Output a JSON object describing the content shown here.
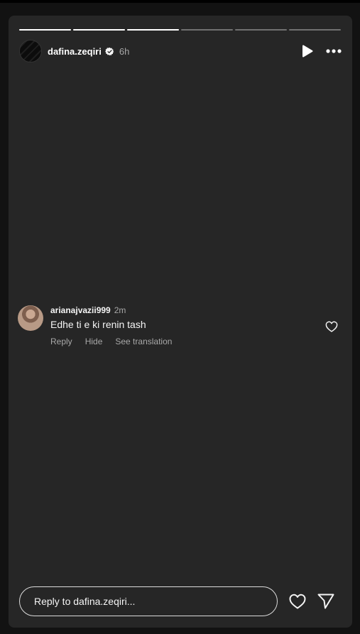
{
  "story": {
    "progress_segments": [
      {
        "fill": 1.0
      },
      {
        "fill": 1.0
      },
      {
        "fill": 1.0
      },
      {
        "fill": 0.0
      },
      {
        "fill": 0.0
      },
      {
        "fill": 0.0
      }
    ],
    "header": {
      "username": "dafina.zeqiri",
      "verified": true,
      "time": "6h",
      "play_icon": "play-icon",
      "more_icon": "more-horizontal-icon"
    },
    "comment": {
      "username": "arianajvazii999",
      "time": "2m",
      "text": "Edhe ti e ki renin tash",
      "actions": {
        "reply": "Reply",
        "hide": "Hide",
        "translate": "See translation"
      },
      "like_icon": "heart-outline-icon"
    },
    "footer": {
      "reply_placeholder": "Reply to dafina.zeqiri...",
      "like_icon": "heart-outline-icon",
      "share_icon": "send-icon"
    }
  },
  "colors": {
    "story_bg": "#262626",
    "page_bg": "#121212",
    "text_primary": "#f5f5f5",
    "text_secondary": "#a8a8a8"
  }
}
